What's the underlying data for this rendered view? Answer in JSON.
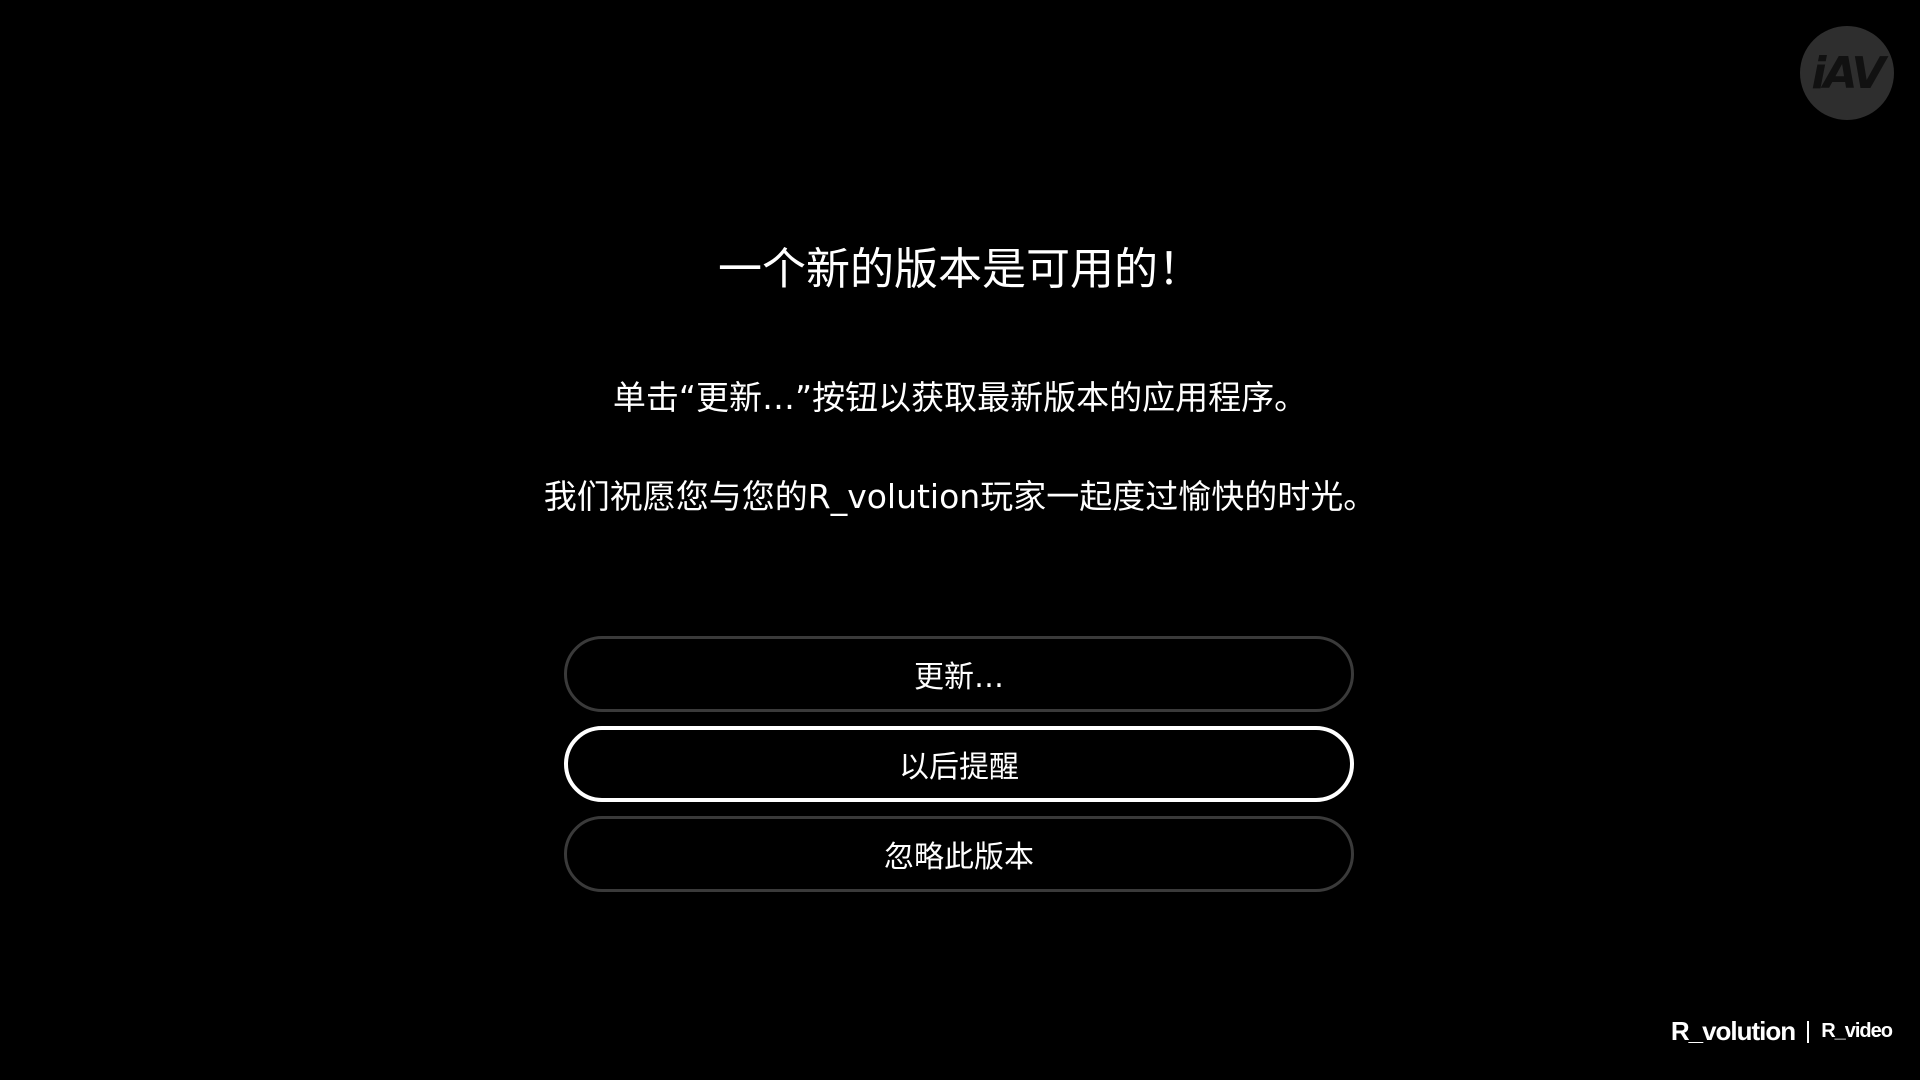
{
  "badge": {
    "text": "iAV"
  },
  "dialog": {
    "title": "一个新的版本是可用的！",
    "message_1": "单击“更新…”按钮以获取最新版本的应用程序。",
    "message_2": "我们祝愿您与您的R_volution玩家一起度过愉快的时光。",
    "buttons": {
      "update": "更新…",
      "remind_later": "以后提醒",
      "ignore": "忽略此版本"
    },
    "focused_button": "remind_later"
  },
  "brand": {
    "main": "R_volution",
    "sub": "R_video"
  },
  "colors": {
    "background": "#000000",
    "text": "#ffffff",
    "button_border": "#3a3a3a",
    "button_focus_border": "#ffffff",
    "badge_background": "#2e2e2e"
  }
}
